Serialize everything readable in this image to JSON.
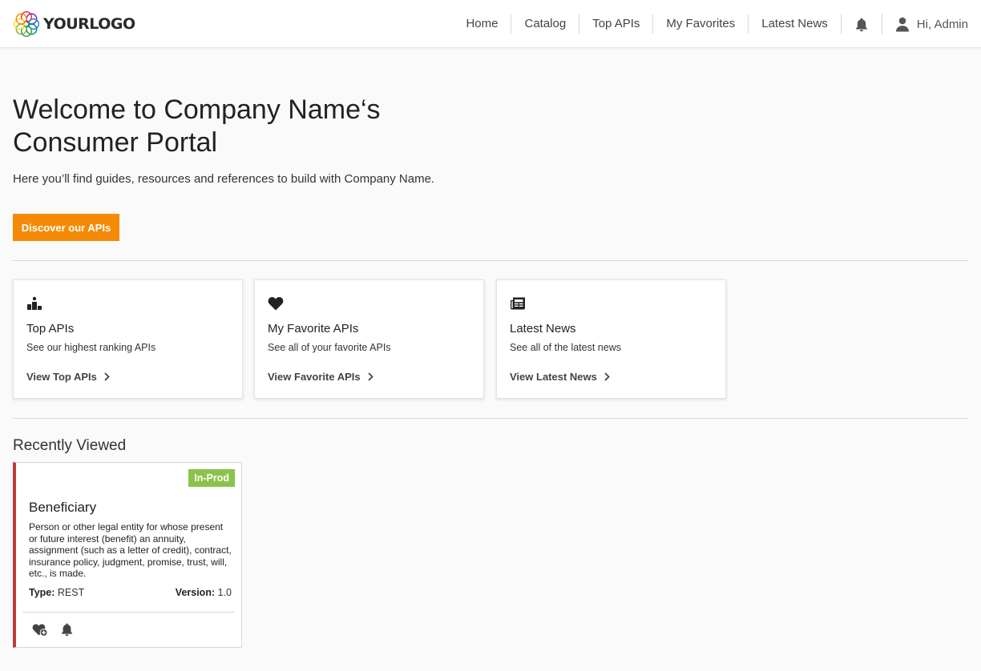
{
  "brand": {
    "logo_text": "YOURLOGO",
    "accent": "#f58a07"
  },
  "nav": {
    "items": [
      {
        "label": "Home"
      },
      {
        "label": "Catalog"
      },
      {
        "label": "Top APIs"
      },
      {
        "label": "My Favorites"
      },
      {
        "label": "Latest News"
      }
    ],
    "notification_icon": "bell-icon",
    "user_icon": "user-icon",
    "user_label": "Hi, Admin"
  },
  "hero": {
    "title": "Welcome to Company Name‘s Consumer Portal",
    "subtitle": "Here you’ll find guides, resources and references to build with Company Name.",
    "cta_label": "Discover our APIs"
  },
  "cards": [
    {
      "icon": "podium-icon",
      "title": "Top APIs",
      "description": "See our highest ranking APIs",
      "link": "View Top APIs"
    },
    {
      "icon": "heart-icon",
      "title": "My Favorite APIs",
      "description": "See all of your favorite APIs",
      "link": "View Favorite APIs"
    },
    {
      "icon": "newspaper-icon",
      "title": "Latest News",
      "description": "See all of the latest news",
      "link": "View Latest News"
    }
  ],
  "recently_viewed": {
    "title": "Recently Viewed",
    "items": [
      {
        "status": "In-Prod",
        "status_color": "#8bc34a",
        "accent_color": "#c0393b",
        "name": "Beneficiary",
        "description": "Person or other legal entity for whose present or future interest (benefit) an annuity, assignment (such as a letter of credit), contract, insurance policy, judgment, promise, trust, will, etc., is made.",
        "type_label": "Type:",
        "type_value": "REST",
        "version_label": "Version:",
        "version_value": "1.0",
        "actions": [
          "favorite-add-icon",
          "bell-icon"
        ]
      }
    ]
  }
}
